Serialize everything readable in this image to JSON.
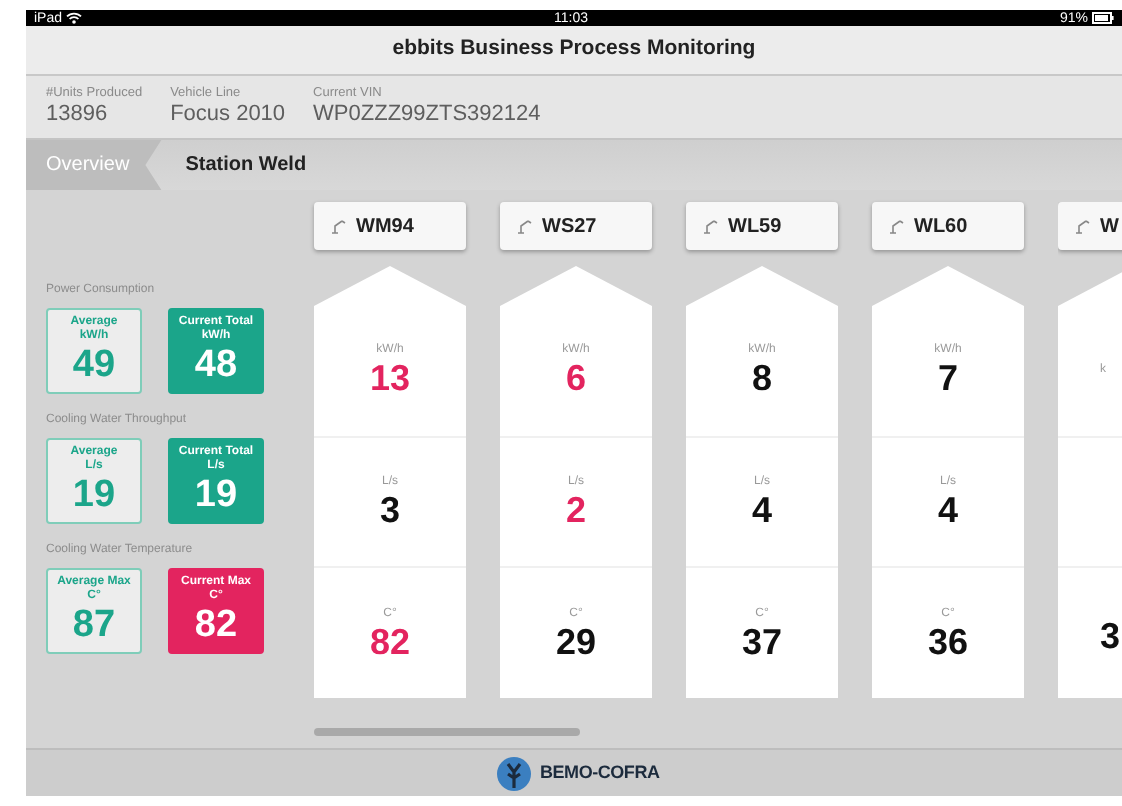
{
  "status_bar": {
    "device": "iPad",
    "time": "11:03",
    "battery": "91%"
  },
  "title": "ebbits Business Process Monitoring",
  "info": [
    {
      "label": "#Units Produced",
      "value": "13896"
    },
    {
      "label": "Vehicle Line",
      "value": "Focus 2010"
    },
    {
      "label": "Current VIN",
      "value": "WP0ZZZ99ZTS392124"
    }
  ],
  "breadcrumb": [
    {
      "label": "Overview",
      "selected": false
    },
    {
      "label": "Station Weld",
      "selected": true
    }
  ],
  "metrics": [
    {
      "title": "Power Consumption",
      "tiles": [
        {
          "kind": "average",
          "label": "Average",
          "unit": "kW/h",
          "value": "49",
          "alert": false
        },
        {
          "kind": "current",
          "label": "Current Total",
          "unit": "kW/h",
          "value": "48",
          "alert": false
        }
      ]
    },
    {
      "title": "Cooling Water Throughput",
      "tiles": [
        {
          "kind": "average",
          "label": "Average",
          "unit": "L/s",
          "value": "19",
          "alert": false
        },
        {
          "kind": "current",
          "label": "Current Total",
          "unit": "L/s",
          "value": "19",
          "alert": false
        }
      ]
    },
    {
      "title": "Cooling Water Temperature",
      "tiles": [
        {
          "kind": "average",
          "label": "Average Max",
          "unit": "C°",
          "value": "87",
          "alert": false
        },
        {
          "kind": "current",
          "label": "Current Max",
          "unit": "C°",
          "value": "82",
          "alert": true
        }
      ]
    }
  ],
  "stations": [
    {
      "name": "WM94",
      "power": {
        "unit": "kW/h",
        "value": "13",
        "alert": true
      },
      "flow": {
        "unit": "L/s",
        "value": "3",
        "alert": false
      },
      "temperature": {
        "unit": "C°",
        "value": "82",
        "alert": true
      }
    },
    {
      "name": "WS27",
      "power": {
        "unit": "kW/h",
        "value": "6",
        "alert": true
      },
      "flow": {
        "unit": "L/s",
        "value": "2",
        "alert": true
      },
      "temperature": {
        "unit": "C°",
        "value": "29",
        "alert": false
      }
    },
    {
      "name": "WL59",
      "power": {
        "unit": "kW/h",
        "value": "8",
        "alert": false
      },
      "flow": {
        "unit": "L/s",
        "value": "4",
        "alert": false
      },
      "temperature": {
        "unit": "C°",
        "value": "37",
        "alert": false
      }
    },
    {
      "name": "WL60",
      "power": {
        "unit": "kW/h",
        "value": "7",
        "alert": false
      },
      "flow": {
        "unit": "L/s",
        "value": "4",
        "alert": false
      },
      "temperature": {
        "unit": "C°",
        "value": "36",
        "alert": false
      }
    },
    {
      "name": "W",
      "power": {
        "unit": "k"
      },
      "temperature": {
        "value": "3",
        "alert": false
      }
    }
  ],
  "footer": {
    "brand": "BEMO-COFRA"
  }
}
